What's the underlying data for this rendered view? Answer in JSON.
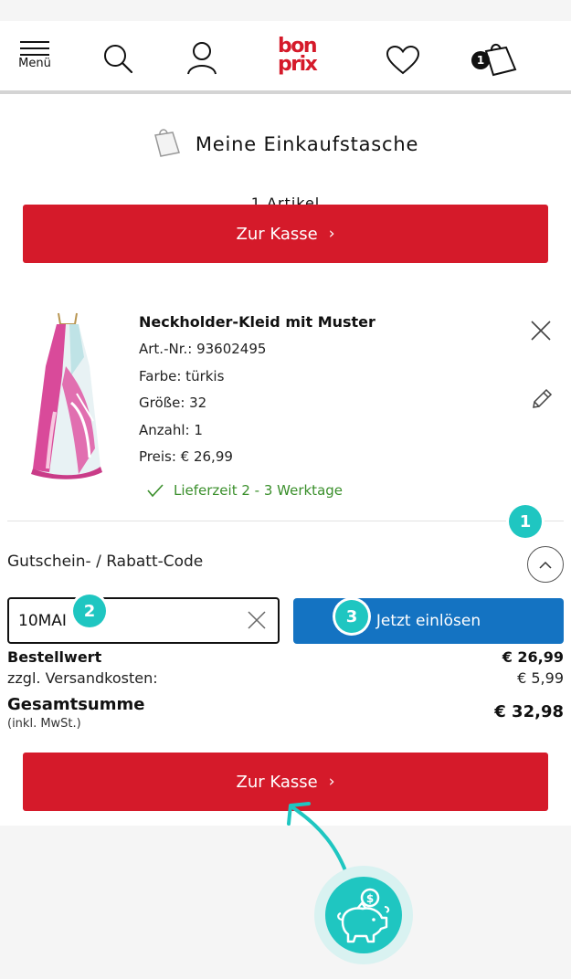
{
  "header": {
    "menu_label": "Menü",
    "logo_line1": "bon",
    "logo_line2": "prix",
    "cart_count": "1",
    "brand_color": "#d51a2a"
  },
  "basket": {
    "title": "Meine Einkaufstasche",
    "article_count": "1 Artikel",
    "checkout_label": "Zur Kasse",
    "checkout_chevron": "›"
  },
  "product": {
    "name": "Neckholder-Kleid mit Muster",
    "article_no": "Art.-Nr.: 93602495",
    "color": "Farbe: türkis",
    "size": "Größe: 32",
    "quantity": "Anzahl: 1",
    "price": "Preis: € 26,99",
    "delivery": "Lieferzeit 2 - 3 Werktage",
    "delivery_color": "#3a8f2b"
  },
  "coupon": {
    "label": "Gutschein- / Rabatt-Code",
    "value": "10MAI",
    "redeem_label": "Jetzt einlösen",
    "accent": "#1473c2"
  },
  "summary": {
    "order_value_label": "Bestellwert",
    "order_value": "€ 26,99",
    "shipping_label": "zzgl. Versandkosten:",
    "shipping_value": "€ 5,99",
    "total_label": "Gesamtsumme",
    "total_value": "€ 32,98",
    "vat_note": "(inkl. MwSt.)"
  },
  "markers": [
    "1",
    "2",
    "3"
  ],
  "marker_color": "#1fc6c1",
  "icons": [
    "menu-icon",
    "search-icon",
    "account-icon",
    "wishlist-heart-icon",
    "shopping-bag-icon",
    "close-icon",
    "edit-pencil-icon",
    "checkmark-icon",
    "chevron-up-icon",
    "piggy-bank-icon"
  ]
}
